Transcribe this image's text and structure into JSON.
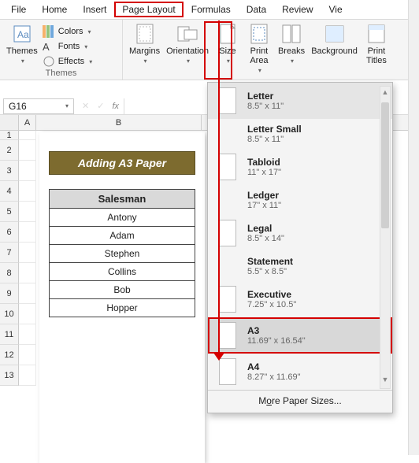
{
  "tabs": {
    "file": "File",
    "home": "Home",
    "insert": "Insert",
    "pagelayout": "Page Layout",
    "formulas": "Formulas",
    "data": "Data",
    "review": "Review",
    "view": "Vie"
  },
  "ribbon": {
    "themes_group": "Themes",
    "themes": "Themes",
    "colors": "Colors",
    "fonts": "Fonts",
    "effects": "Effects",
    "margins": "Margins",
    "orientation": "Orientation",
    "size": "Size",
    "printarea": "Print\nArea",
    "breaks": "Breaks",
    "background": "Background",
    "printtitles": "Print\nTitles"
  },
  "namebox": "G16",
  "fx": "fx",
  "cols": {
    "A": "A",
    "B": "B"
  },
  "rows": [
    "1",
    "2",
    "3",
    "4",
    "5",
    "6",
    "7",
    "8",
    "9",
    "10",
    "11",
    "12",
    "13"
  ],
  "sheet": {
    "title": "Adding A3 Paper",
    "header": "Salesman",
    "data": [
      "Antony",
      "Adam",
      "Stephen",
      "Collins",
      "Bob",
      "Hopper"
    ]
  },
  "sizes": [
    {
      "name": "Letter",
      "dim": "8.5\" x 11\"",
      "icon": "tall",
      "state": "hover"
    },
    {
      "name": "Letter Small",
      "dim": "8.5\" x 11\"",
      "icon": "none"
    },
    {
      "name": "Tabloid",
      "dim": "11\" x 17\"",
      "icon": "tall"
    },
    {
      "name": "Ledger",
      "dim": "17\" x 11\"",
      "icon": "none"
    },
    {
      "name": "Legal",
      "dim": "8.5\" x 14\"",
      "icon": "tall"
    },
    {
      "name": "Statement",
      "dim": "5.5\" x 8.5\"",
      "icon": "none"
    },
    {
      "name": "Executive",
      "dim": "7.25\" x 10.5\"",
      "icon": "tall"
    },
    {
      "name": "A3",
      "dim": "11.69\" x 16.54\"",
      "icon": "tall",
      "state": "sel"
    },
    {
      "name": "A4",
      "dim": "8.27\" x 11.69\"",
      "icon": "tall"
    }
  ],
  "more": {
    "pre": "M",
    "u": "o",
    "post": "re Paper Sizes..."
  }
}
